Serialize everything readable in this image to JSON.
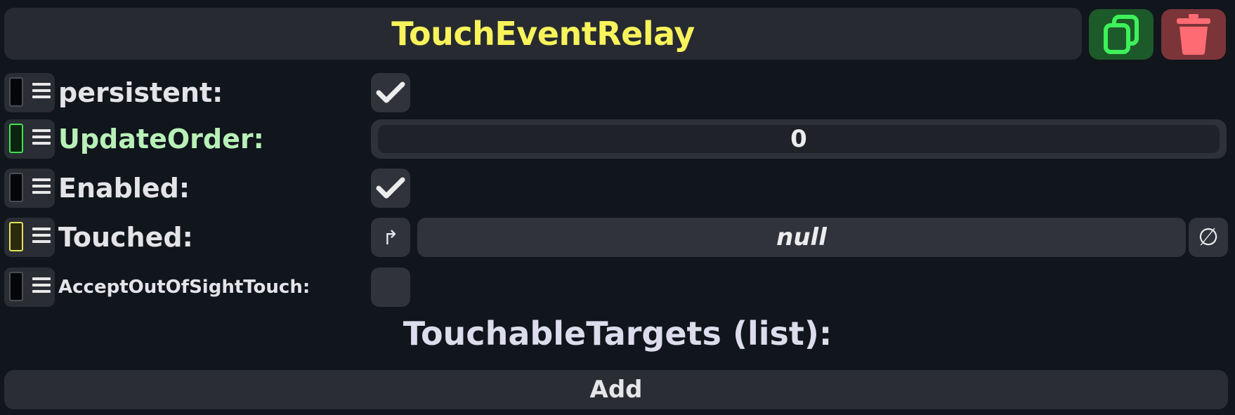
{
  "component": {
    "title": "TouchEventRelay",
    "duplicate_icon": "duplicate-icon",
    "delete_icon": "trash-icon",
    "colors": {
      "title": "#f7f35b",
      "duplicate_bg": "#1d5a29",
      "duplicate_fg": "#3ef05a",
      "delete_bg": "#7b3438",
      "delete_fg": "#ff6b73"
    }
  },
  "fields": {
    "persistent": {
      "label": "persistent:",
      "checked": true
    },
    "update_order": {
      "label": "UpdateOrder:",
      "value": "0",
      "label_color": "#b8f0b8"
    },
    "enabled": {
      "label": "Enabled:",
      "checked": true
    },
    "touched": {
      "label": "Touched:",
      "value": "null",
      "pick_icon": "↱",
      "clear_icon": "∅"
    },
    "accept_out_of_sight": {
      "label": "AcceptOutOfSightTouch:",
      "checked": false
    }
  },
  "list": {
    "title": "TouchableTargets (list):",
    "add_label": "Add"
  }
}
